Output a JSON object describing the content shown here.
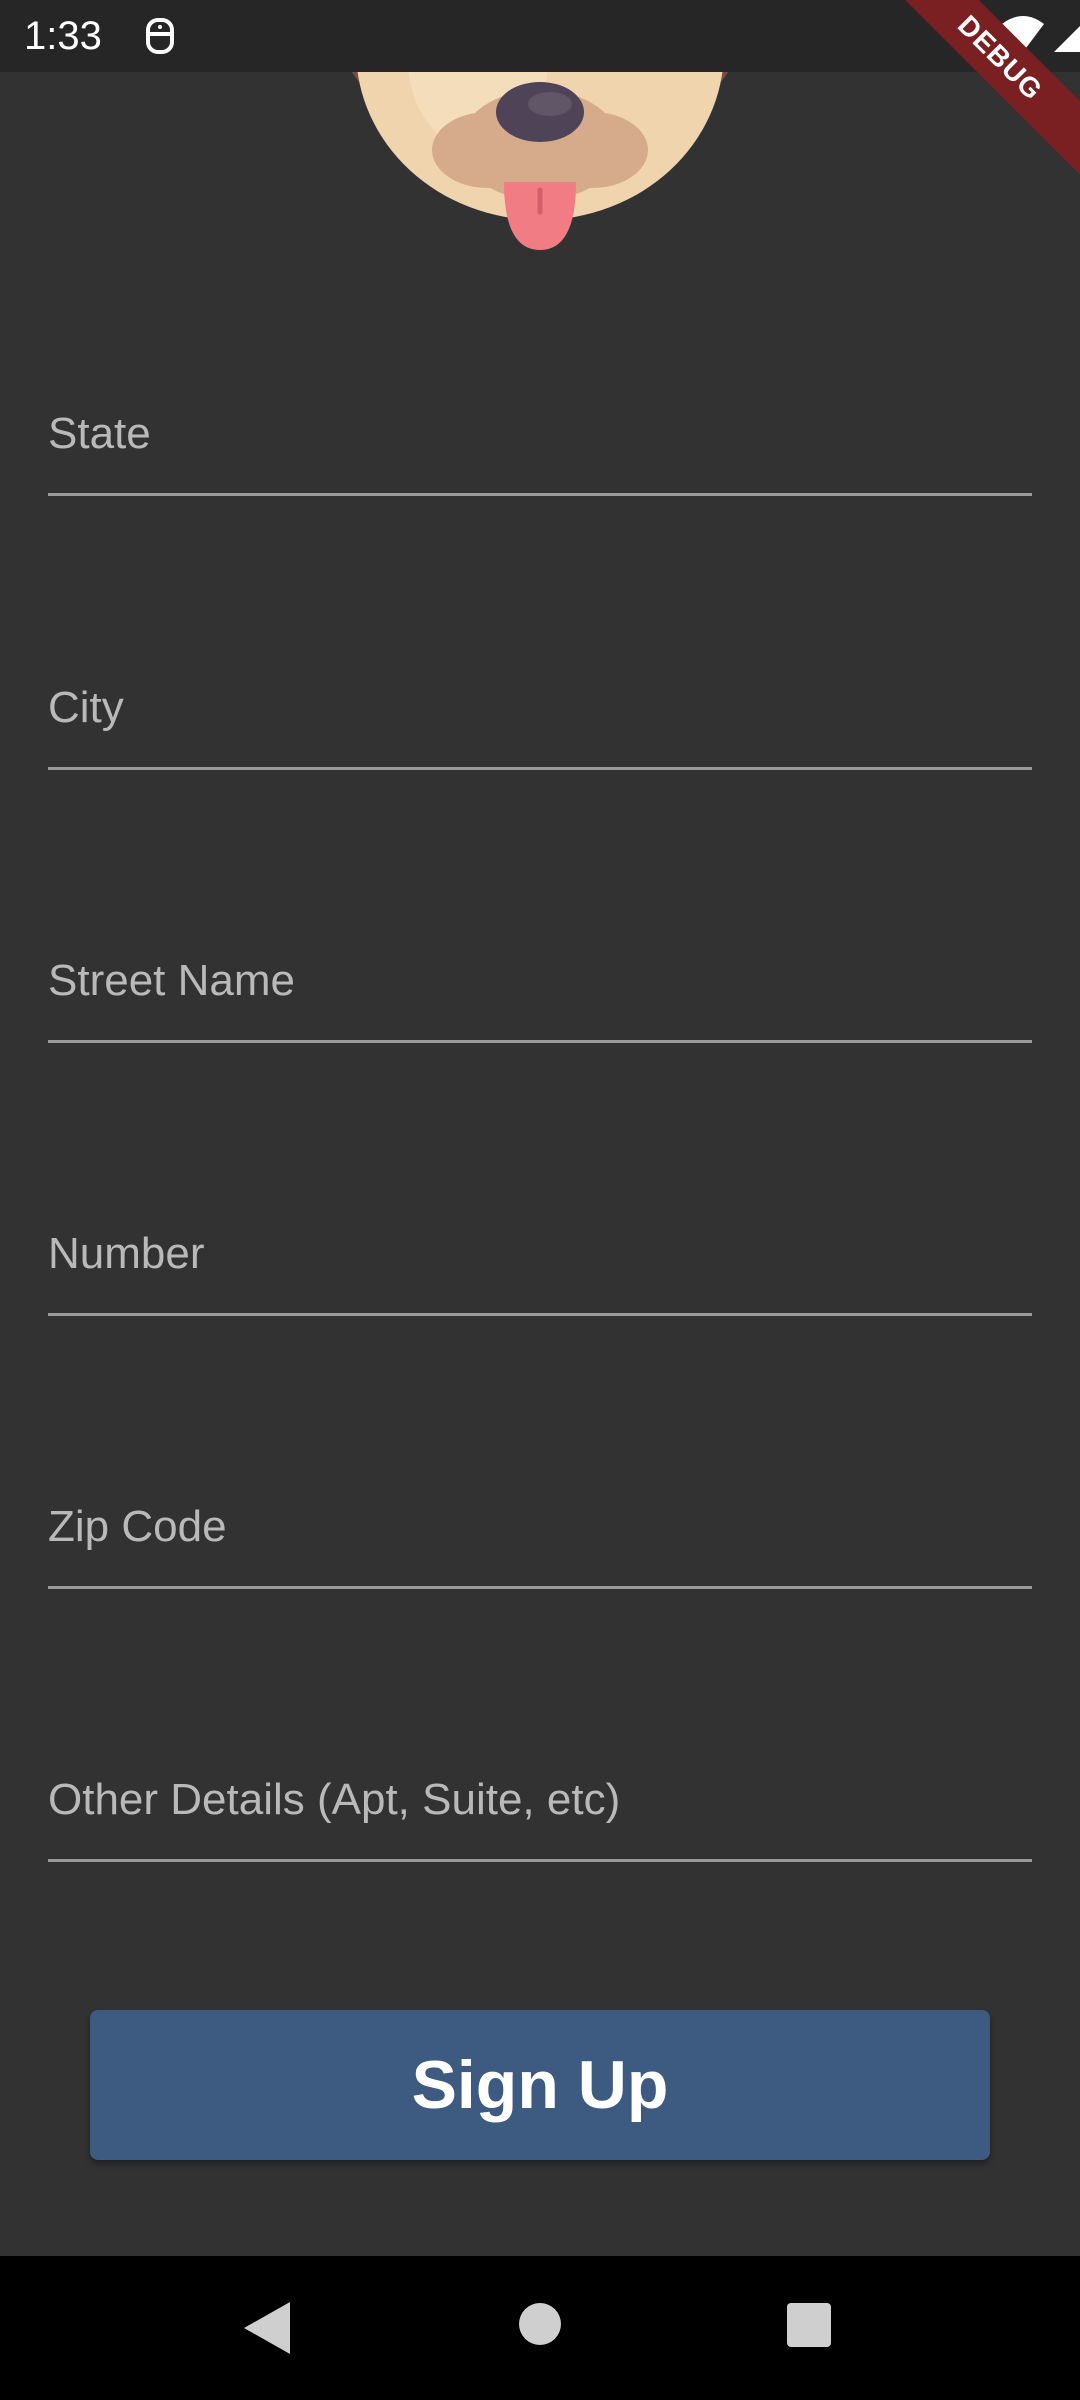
{
  "status_bar": {
    "time": "1:33"
  },
  "debug_banner": {
    "label": "DEBUG"
  },
  "form": {
    "fields": [
      {
        "placeholder": "State",
        "value": ""
      },
      {
        "placeholder": "City",
        "value": ""
      },
      {
        "placeholder": "Street Name",
        "value": ""
      },
      {
        "placeholder": "Number",
        "value": ""
      },
      {
        "placeholder": "Zip Code",
        "value": ""
      },
      {
        "placeholder": "Other Details (Apt, Suite, etc)",
        "value": ""
      }
    ],
    "submit_label": "Sign Up"
  },
  "colors": {
    "background": "#323232",
    "button": "#3d5a80",
    "underline": "#9a9a9a",
    "debug_banner": "#7a1f22"
  },
  "icons": {
    "status": [
      "app-notification-icon",
      "wifi-icon",
      "signal-icon",
      "battery-icon"
    ],
    "navigation": [
      "back-icon",
      "home-icon",
      "recents-icon"
    ]
  }
}
